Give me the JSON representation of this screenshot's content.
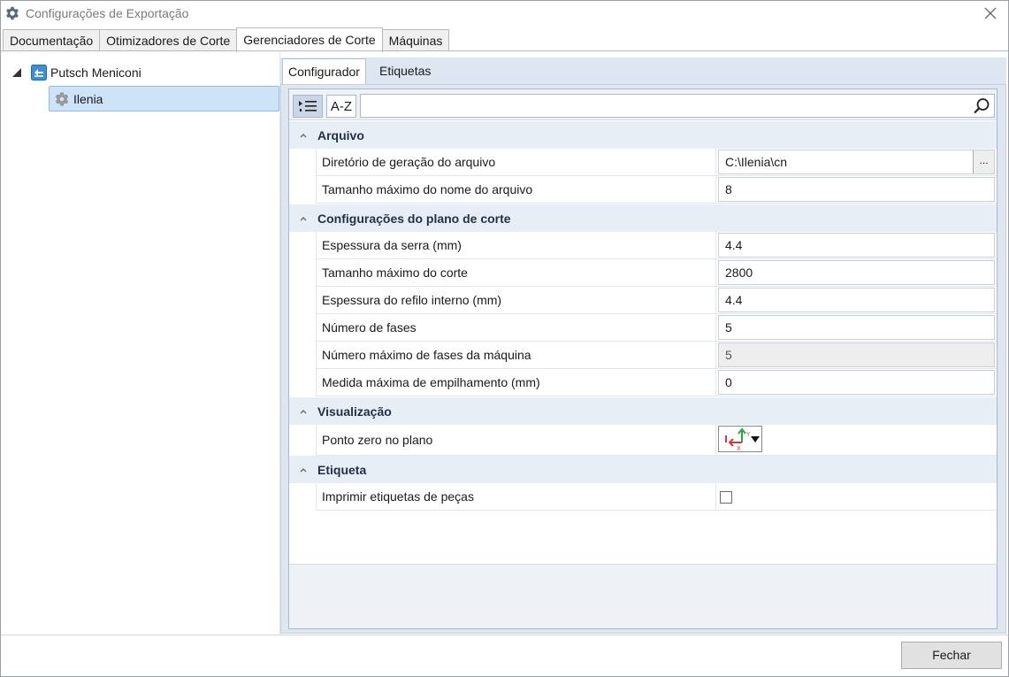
{
  "window": {
    "title": "Configurações de Exportação",
    "icon": "gear-icon",
    "close_icon": "close-icon"
  },
  "main_tabs": [
    {
      "label": "Documentação",
      "active": false
    },
    {
      "label": "Otimizadores de Corte",
      "active": false
    },
    {
      "label": "Gerenciadores de Corte",
      "active": true
    },
    {
      "label": "Máquinas",
      "active": false
    }
  ],
  "tree": {
    "root": {
      "label": "Putsch Meniconi",
      "icon": "machine-icon",
      "expanded": true
    },
    "child": {
      "label": "Ilenia",
      "icon": "gear-icon",
      "selected": true
    }
  },
  "sub_tabs": [
    {
      "label": "Configurador",
      "active": true
    },
    {
      "label": "Etiquetas",
      "active": false
    }
  ],
  "toolbar": {
    "categorized_icon": "categorized-icon",
    "alphabetical_label": "A-Z",
    "search_value": "",
    "search_icon": "search-icon"
  },
  "categories": [
    {
      "name": "Arquivo",
      "properties": [
        {
          "label": "Diretório de geração do arquivo",
          "value": "C:\\Ilenia\\cn",
          "browse_label": "..."
        },
        {
          "label": "Tamanho máximo do nome do arquivo",
          "value": "8"
        }
      ]
    },
    {
      "name": "Configurações do plano de corte",
      "properties": [
        {
          "label": "Espessura da serra (mm)",
          "value": "4.4"
        },
        {
          "label": "Tamanho máximo do corte",
          "value": "2800"
        },
        {
          "label": "Espessura do refilo interno (mm)",
          "value": "4.4"
        },
        {
          "label": "Número de fases",
          "value": "5"
        },
        {
          "label": "Número máximo de fases da máquina",
          "value": "5",
          "readonly": true
        },
        {
          "label": "Medida máxima de empilhamento (mm)",
          "value": "0"
        }
      ]
    },
    {
      "name": "Visualização",
      "properties": [
        {
          "label": "Ponto zero no plano",
          "value_icon": "axis-origin-icon"
        }
      ]
    },
    {
      "name": "Etiqueta",
      "properties": [
        {
          "label": "Imprimir etiquetas de peças",
          "checked": false
        }
      ]
    }
  ],
  "footer": {
    "close_button": "Fechar"
  }
}
